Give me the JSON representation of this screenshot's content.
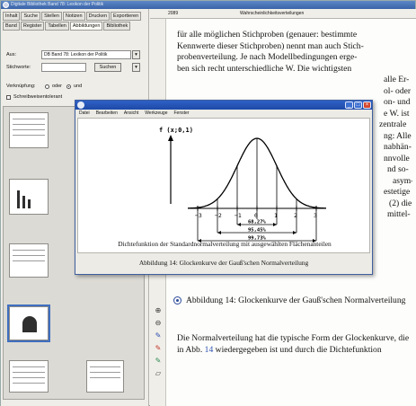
{
  "main_window": {
    "title": "Digitale Bibliothek Band 78: Lexikon der Politik"
  },
  "left_panel": {
    "tabs_row1": [
      "Inhalt",
      "Suche",
      "Stellen",
      "Notizen",
      "Drucken",
      "Exportieren"
    ],
    "tabs_row2": [
      "Band",
      "Register",
      "Tabellen",
      "Abbildungen",
      "Bibliothek"
    ],
    "aus_label": "Aus:",
    "aus_value": "DB Band 78: Lexikon der Politik",
    "stichworte_label": "Stichworte:",
    "suchen_label": "Suchen",
    "verknuepfung_label": "Verknüpfung:",
    "oder_label": "oder",
    "und_label": "und",
    "checkbox_label": "Schreibweisentolerant"
  },
  "content": {
    "page_number": "2089",
    "section_title": "Wahrscheinlichkeitsverteilungen",
    "body_lines": [
      "für alle möglichen Stichproben (genauer: bestimmte",
      "Kennwerte dieser Stichproben) nennt man auch Stich-",
      "probenverteilung. Je nach Modellbedingungen erge-",
      "ben sich recht unterschiedliche W. Die wichtigsten",
      "alle Er-",
      "ol- oder",
      "on- und",
      "e W. ist",
      "zentrale",
      "ng: Alle",
      "nabhän-",
      "nnvolle",
      "nd so-",
      "asym-",
      "estetige",
      "(2) die",
      "mittel-"
    ],
    "figure_caption": "Abbildung 14: Glockenkurve der Gauß'schen Normalverteilung",
    "para2_before": "Die Normalverteilung hat die typische Form der Glockenkurve, die in Abb.",
    "para2_link": "14",
    "para2_after": "wiedergegeben ist und durch die Dichtefunktion"
  },
  "popup": {
    "menu": [
      "Datei",
      "Bearbeiten",
      "Ansicht",
      "Werkzeuge",
      "Fenster"
    ],
    "plot_caption": "Dichtefunktion der Standardnormalverteilung mit ausgewählten Flächenanteilen",
    "status_caption": "Abbildung 14: Glockenkurve der Gauß'schen Normalverteilung"
  },
  "chart_data": {
    "type": "line",
    "title": "Dichtefunktion der Standardnormalverteilung mit ausgewählten Flächenanteilen",
    "ylabel": "f (x;0,1)",
    "xlabel": "",
    "x_ticks": [
      "-3",
      "-2",
      "-1",
      "0",
      "1",
      "2",
      "3"
    ],
    "xlim": [
      -3.5,
      3.5
    ],
    "series": [
      {
        "function": "standard normal density",
        "mu": 0,
        "sigma": 1
      }
    ],
    "annotations": [
      {
        "label": "68,27%",
        "from": -1,
        "to": 1
      },
      {
        "label": "95,45%",
        "from": -2,
        "to": 2
      },
      {
        "label": "99,73%",
        "from": -3,
        "to": 3
      }
    ],
    "grid": false
  },
  "colors": {
    "title_bar": "#3a64a8",
    "popup_title_bar": "#1d49a8",
    "link": "#2a4fb0"
  },
  "icons": [
    "app-icon",
    "zoom-in-icon",
    "zoom-out-icon",
    "pen-icon",
    "marker-icon",
    "pencil-icon",
    "eraser-icon",
    "minimize-icon",
    "maximize-icon",
    "close-icon",
    "caption-bullet-icon"
  ]
}
